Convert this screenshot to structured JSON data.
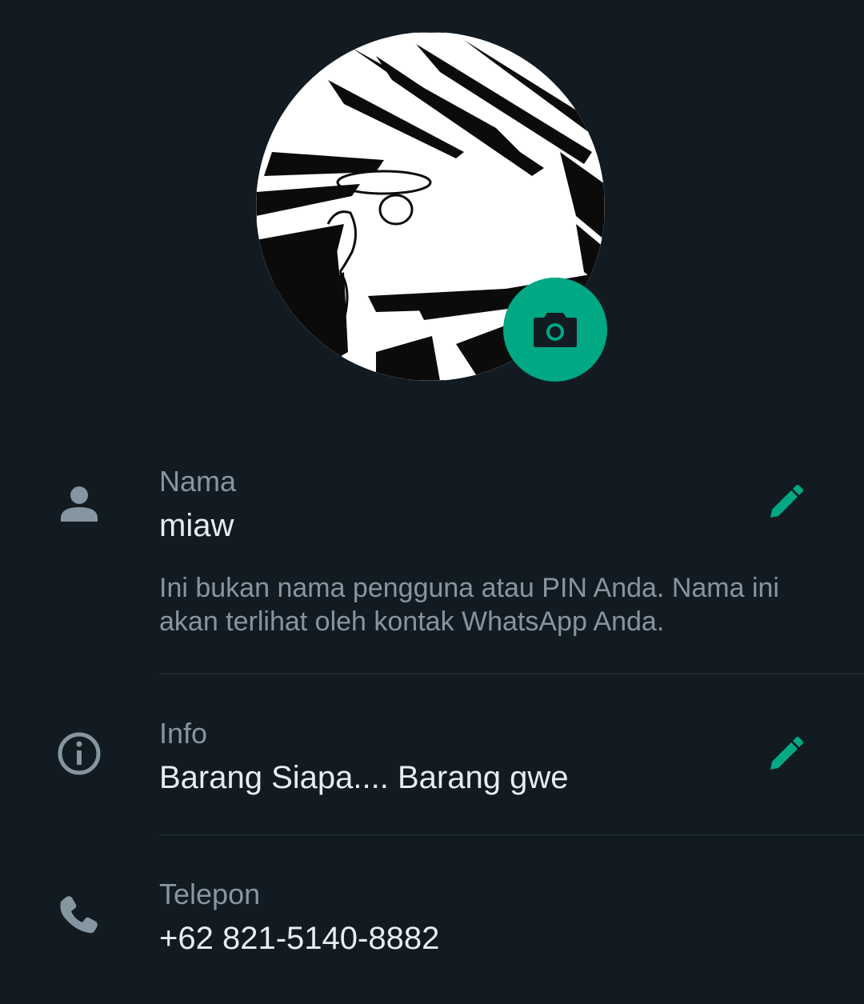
{
  "profile": {
    "photo_alt": "profile photo",
    "camera_icon": "camera-icon"
  },
  "name": {
    "icon": "person-icon",
    "label": "Nama",
    "value": "miaw",
    "hint": "Ini bukan nama pengguna atau PIN Anda. Nama ini akan terlihat oleh kontak WhatsApp Anda.",
    "edit_icon": "pencil-icon"
  },
  "about": {
    "icon": "info-icon",
    "label": "Info",
    "value": "Barang Siapa.... Barang gwe",
    "edit_icon": "pencil-icon"
  },
  "phone": {
    "icon": "phone-icon",
    "label": "Telepon",
    "value": "+62 821-5140-8882"
  },
  "colors": {
    "background": "#121b22",
    "accent": "#00a884",
    "text_primary": "#e9edef",
    "text_secondary": "#8696a0",
    "divider": "#233138"
  }
}
